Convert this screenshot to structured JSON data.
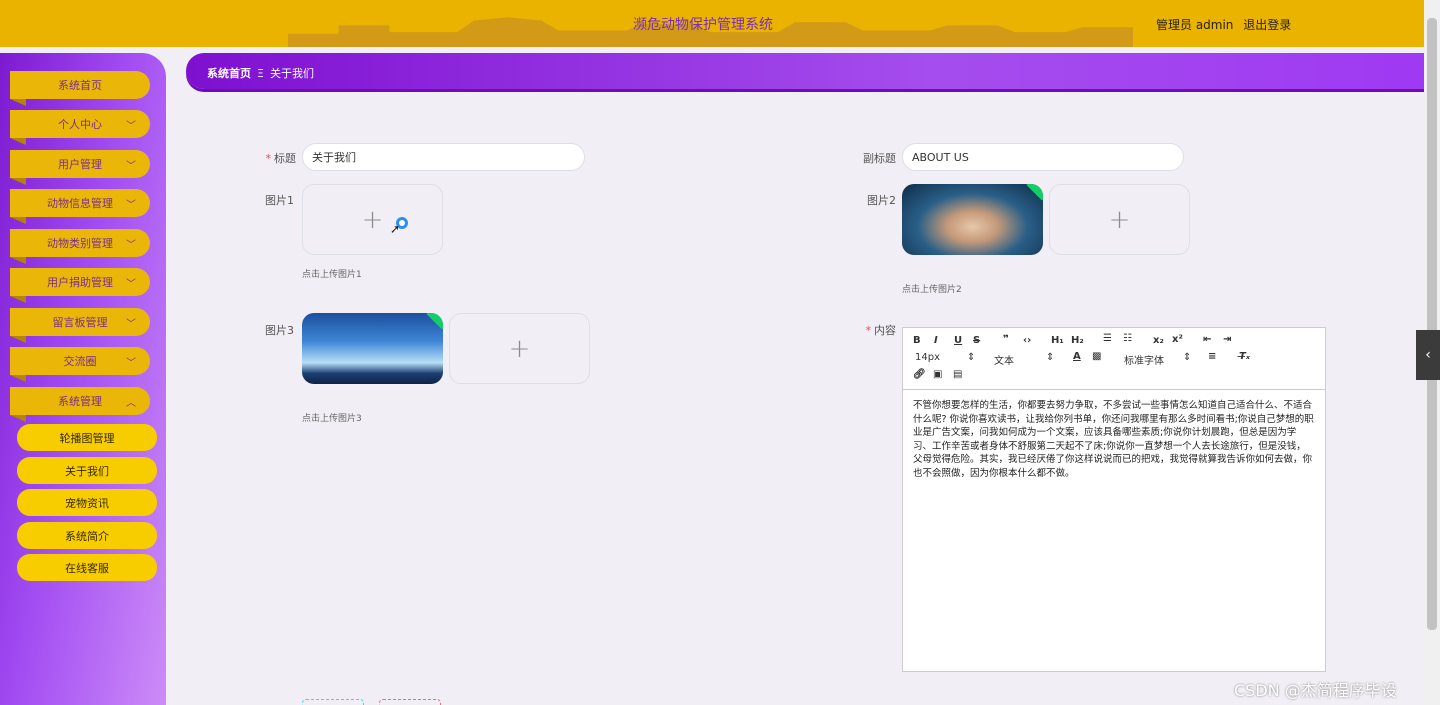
{
  "header": {
    "title": "濒危动物保护管理系统",
    "user_label": "管理员 admin",
    "logout_label": "退出登录"
  },
  "sidebar": {
    "items": [
      {
        "label": "系统首页"
      },
      {
        "label": "个人中心"
      },
      {
        "label": "用户管理"
      },
      {
        "label": "动物信息管理"
      },
      {
        "label": "动物类别管理"
      },
      {
        "label": "用户捐助管理"
      },
      {
        "label": "留言板管理"
      },
      {
        "label": "交流圈"
      },
      {
        "label": "系统管理"
      }
    ],
    "sub_items": [
      {
        "label": "轮播图管理"
      },
      {
        "label": "关于我们"
      },
      {
        "label": "宠物资讯"
      },
      {
        "label": "系统简介"
      },
      {
        "label": "在线客服"
      }
    ]
  },
  "breadcrumb": {
    "home": "系统首页",
    "separator": "Ξ",
    "current": "关于我们"
  },
  "form": {
    "title_label": "标题",
    "title_value": "关于我们",
    "subtitle_label": "副标题",
    "subtitle_value": "ABOUT US",
    "image1_label": "图片1",
    "image1_hint": "点击上传图片1",
    "image2_label": "图片2",
    "image2_hint": "点击上传图片2",
    "image3_label": "图片3",
    "image3_hint": "点击上传图片3",
    "content_label": "内容",
    "required_mark": "*",
    "upload_plus": "+"
  },
  "editor": {
    "font_size": "14px",
    "block_format": "文本",
    "font_family": "标准字体",
    "content": "不管你想要怎样的生活，你都要去努力争取，不多尝试一些事情怎么知道自己适合什么、不适合什么呢? 你说你喜欢读书，让我给你列书单，你还问我哪里有那么多时间看书;你说自己梦想的职业是广告文案，问我如何成为一个文案，应该具备哪些素质;你说你计划晨跑，但总是因为学习、工作辛苦或者身体不舒服第二天起不了床;你说你一直梦想一个人去长途旅行，但是没钱，父母觉得危险。其实，我已经厌倦了你这样说说而已的把戏，我觉得就算我告诉你如何去做，你也不会照做，因为你根本什么都不做。"
  },
  "watermark": "CSDN @杰简程序毕设",
  "colors": {
    "header_bg": "#e9b300",
    "title_color": "#7d2bbb",
    "sidebar_purple": "#8e2fe0",
    "nav_yellow": "#eab708",
    "success_badge": "#13ce66"
  }
}
